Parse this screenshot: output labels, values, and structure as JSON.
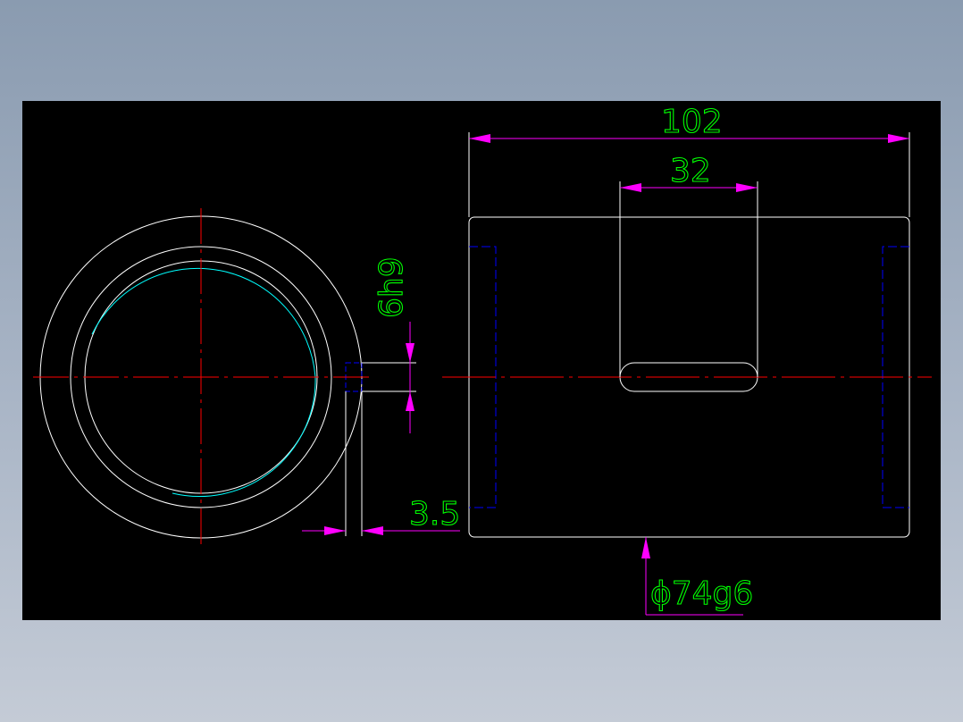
{
  "drawing": {
    "colors": {
      "background": "#000000",
      "outline": "#ffffff",
      "centerline": "#ff0000",
      "dimension_line": "#ff00ff",
      "dimension_text": "#00ff00",
      "hidden_line": "#0000ff",
      "thread_arc": "#00ffff"
    },
    "dimensions": {
      "overall_length": "102",
      "slot_length": "32",
      "key_width": "6h9",
      "wall_offset": "3.5",
      "outer_diameter": "ϕ74g6"
    }
  }
}
